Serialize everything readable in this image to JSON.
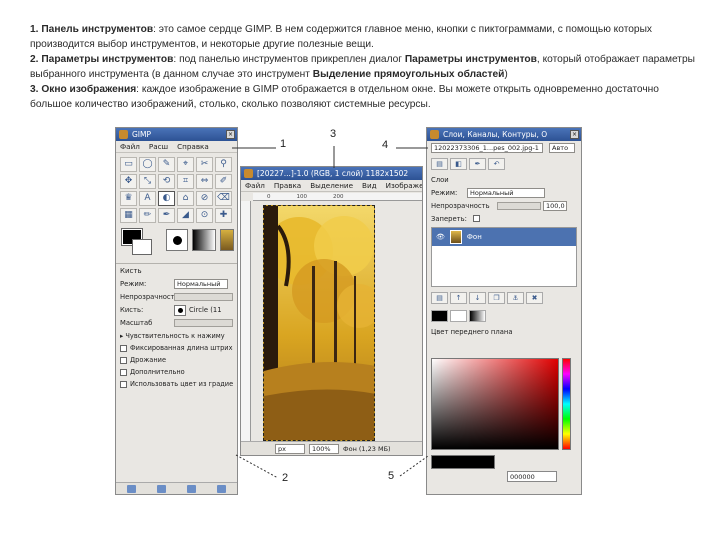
{
  "slide": {
    "p1_head": "1. Панель инструментов",
    "p1_body": ": это самое сердце GIMP. В нем содержится главное меню, кнопки с пиктограммами, с помощью которых производится выбор инструментов, и некоторые другие полезные вещи.",
    "p2_head": "2. Параметры инструментов",
    "p2_body_a": ": под панелью инструментов прикреплен диалог ",
    "p2_bold_a": "Параметры инструментов",
    "p2_body_b": ", который отображает параметры выбранного инструмента (в данном случае это инструмент ",
    "p2_bold_b": "Выделение прямоугольных областей",
    "p2_body_c": ")",
    "p3_head": "3. Окно изображения",
    "p3_body": ": каждое изображение в GIMP отображается в отдельном окне. Вы можете открыть одновременно достаточно большое количество изображений, столько, сколько позволяют системные ресурсы."
  },
  "toolbox": {
    "title": "GIMP",
    "menu": [
      "Файл",
      "Расш",
      "Справка"
    ],
    "tool_glyphs": [
      "▭",
      "◯",
      "✎",
      "⌖",
      "✂",
      "⚲",
      "✥",
      "⤡",
      "⟲",
      "⌗",
      "⇔",
      "✐",
      "♛",
      "A",
      "◐",
      "⌂",
      "⊘",
      "⌫",
      "▦",
      "✏",
      "✒",
      "◢",
      "⊙",
      "✚"
    ],
    "options_title": "Кисть",
    "mode_label": "Режим:",
    "mode_value": "Нормальный",
    "opacity_label": "Непрозрачность",
    "brush_label": "Кисть:",
    "brush_value": "Circle (11",
    "scale_label": "Масштаб",
    "pressure_label": "▸ Чувствительность к нажиму",
    "checkboxes": [
      "Фиксированная длина штриха",
      "Дрожание",
      "Дополнительно",
      "Использовать цвет из градиента"
    ]
  },
  "image_window": {
    "title": "[20227...]-1.0 (RGB, 1 слой) 1182x1502",
    "menu": [
      "Файл",
      "Правка",
      "Выделение",
      "Вид",
      "Изображение"
    ],
    "ruler_ticks": [
      "0",
      "100",
      "200"
    ],
    "unit": "px",
    "zoom": "100%",
    "status": "Фон (1,23 МБ)"
  },
  "layers_dock": {
    "title": "Слои, Каналы, Контуры, О",
    "image_combo": "12022373306_1...pes_002.jpg-1",
    "auto_button": "Авто",
    "layers_label": "Слои",
    "mode_label": "Режим:",
    "mode_value": "Нормальный",
    "opacity_label": "Непрозрачность",
    "opacity_value": "100,0",
    "lock_label": "Запереть:",
    "layer_name": "Фон",
    "layer_buttons": [
      "▤",
      "↑",
      "↓",
      "❐",
      "⚓",
      "✖"
    ],
    "color_title": "Цвет переднего плана",
    "hex_value": "000000"
  },
  "callouts": [
    "1",
    "2",
    "3",
    "4",
    "5"
  ]
}
